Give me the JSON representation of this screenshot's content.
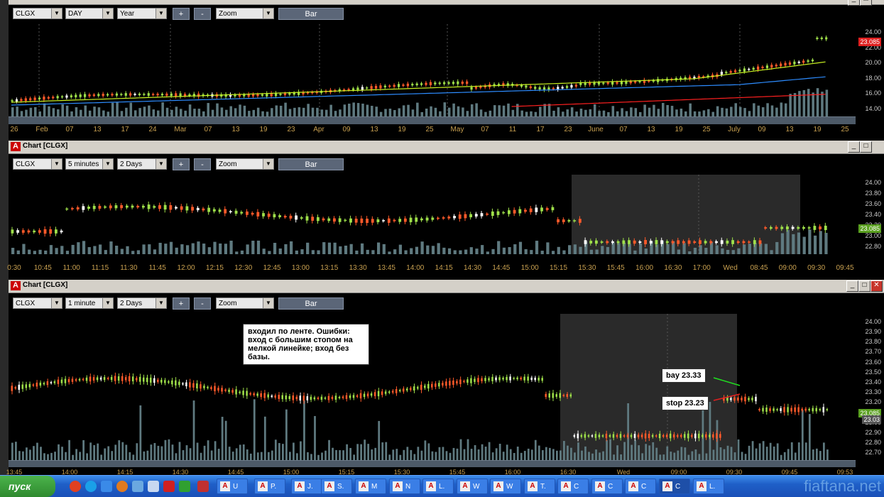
{
  "colors": {
    "up": "#9fe04a",
    "down": "#ff5a2a",
    "doji": "#ffffff",
    "vol": "#5f7a80",
    "ma_fast": "#c8f020",
    "ma_slow": "#2d8cff",
    "ma_long": "#ff2020",
    "grid": "#555",
    "shade": "#2a2a2a"
  },
  "panes": [
    {
      "title": "",
      "symbol": "CLGX",
      "interval": "DAY",
      "range": "Year",
      "zoom": "Zoom",
      "plus": "+",
      "minus": "-",
      "type_btn": "Bar",
      "y_ticks": [
        "24.00",
        "22.00",
        "20.00",
        "18.00",
        "16.00",
        "14.00"
      ],
      "price_tag": "23.085",
      "x_ticks": [
        "26",
        "Feb",
        "07",
        "13",
        "17",
        "24",
        "Mar",
        "07",
        "13",
        "19",
        "23",
        "Apr",
        "09",
        "13",
        "19",
        "25",
        "May",
        "07",
        "11",
        "17",
        "23",
        "June",
        "07",
        "13",
        "19",
        "25",
        "July",
        "09",
        "13",
        "19",
        "25"
      ]
    },
    {
      "title": "Chart [CLGX]",
      "symbol": "CLGX",
      "interval": "5 minutes",
      "range": "2 Days",
      "zoom": "Zoom",
      "plus": "+",
      "minus": "-",
      "type_btn": "Bar",
      "y_ticks": [
        "24.00",
        "23.80",
        "23.60",
        "23.40",
        "23.20",
        "23.00",
        "22.80"
      ],
      "price_tag": "23.085",
      "x_ticks": [
        "0:30",
        "10:45",
        "11:00",
        "11:15",
        "11:30",
        "11:45",
        "12:00",
        "12:15",
        "12:30",
        "12:45",
        "13:00",
        "13:15",
        "13:30",
        "13:45",
        "14:00",
        "14:15",
        "14:30",
        "14:45",
        "15:00",
        "15:15",
        "15:30",
        "15:45",
        "16:00",
        "16:30",
        "17:00",
        "Wed",
        "08:45",
        "09:00",
        "09:30",
        "09:45"
      ]
    },
    {
      "title": "Chart [CLGX]",
      "symbol": "CLGX",
      "interval": "1 minute",
      "range": "2 Days",
      "zoom": "Zoom",
      "plus": "+",
      "minus": "-",
      "type_btn": "Bar",
      "y_ticks": [
        "24.00",
        "23.90",
        "23.80",
        "23.70",
        "23.60",
        "23.50",
        "23.40",
        "23.30",
        "23.20",
        "23.10",
        "23.00",
        "22.90",
        "22.80",
        "22.70"
      ],
      "price_tag": "23.085",
      "price_tag2": "23.03",
      "x_ticks": [
        "13:45",
        "14:00",
        "14:15",
        "14:30",
        "14:45",
        "15:00",
        "15:15",
        "15:30",
        "15:45",
        "16:00",
        "16:30",
        "Wed",
        "09:00",
        "09:30",
        "09:45",
        "09:53"
      ],
      "note": "входил по ленте. Ошибки:\nвход с большим стопом на\nмелкой линейке; вход без\nбазы.",
      "entry_label": "bay 23.33",
      "stop_label": "stop 23.23"
    }
  ],
  "taskbar": {
    "start": "пуск",
    "tasks": [
      "U",
      "P.",
      "J.",
      "S.",
      "M",
      "N",
      "L.",
      "W",
      "W",
      "T.",
      "C",
      "C",
      "C",
      "C",
      "L."
    ],
    "watermark": "fiaftana.net"
  }
}
